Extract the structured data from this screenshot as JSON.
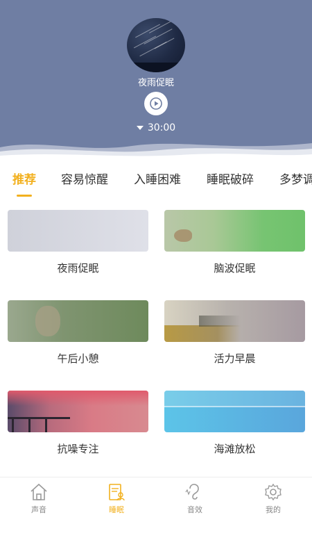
{
  "player": {
    "title": "夜雨促眠",
    "timer": "30:00",
    "cover_icon": "night-sky-cover",
    "play_icon": "play-icon"
  },
  "tabs": [
    {
      "label": "推荐",
      "active": true
    },
    {
      "label": "容易惊醒",
      "active": false
    },
    {
      "label": "入睡困难",
      "active": false
    },
    {
      "label": "睡眠破碎",
      "active": false
    },
    {
      "label": "多梦调",
      "active": false
    }
  ],
  "cards": [
    {
      "label": "夜雨促眠",
      "color": "#d8dae3"
    },
    {
      "label": "脑波促眠",
      "color": "#77c472"
    },
    {
      "label": "午后小憩",
      "color": "#6e8a5c"
    },
    {
      "label": "活力早晨",
      "color": "#a69aa1"
    },
    {
      "label": "抗噪专注",
      "color": "#d97b86"
    },
    {
      "label": "海滩放松",
      "color": "#5aa6dc"
    }
  ],
  "bottom_nav": [
    {
      "label": "声音",
      "icon": "home-icon",
      "active": false
    },
    {
      "label": "睡眠",
      "icon": "sleep-report-icon",
      "active": true
    },
    {
      "label": "音效",
      "icon": "ear-icon",
      "active": false
    },
    {
      "label": "我的",
      "icon": "gear-icon",
      "active": false
    }
  ],
  "colors": {
    "header_bg": "#6f7ea3",
    "accent": "#f2b01e"
  }
}
